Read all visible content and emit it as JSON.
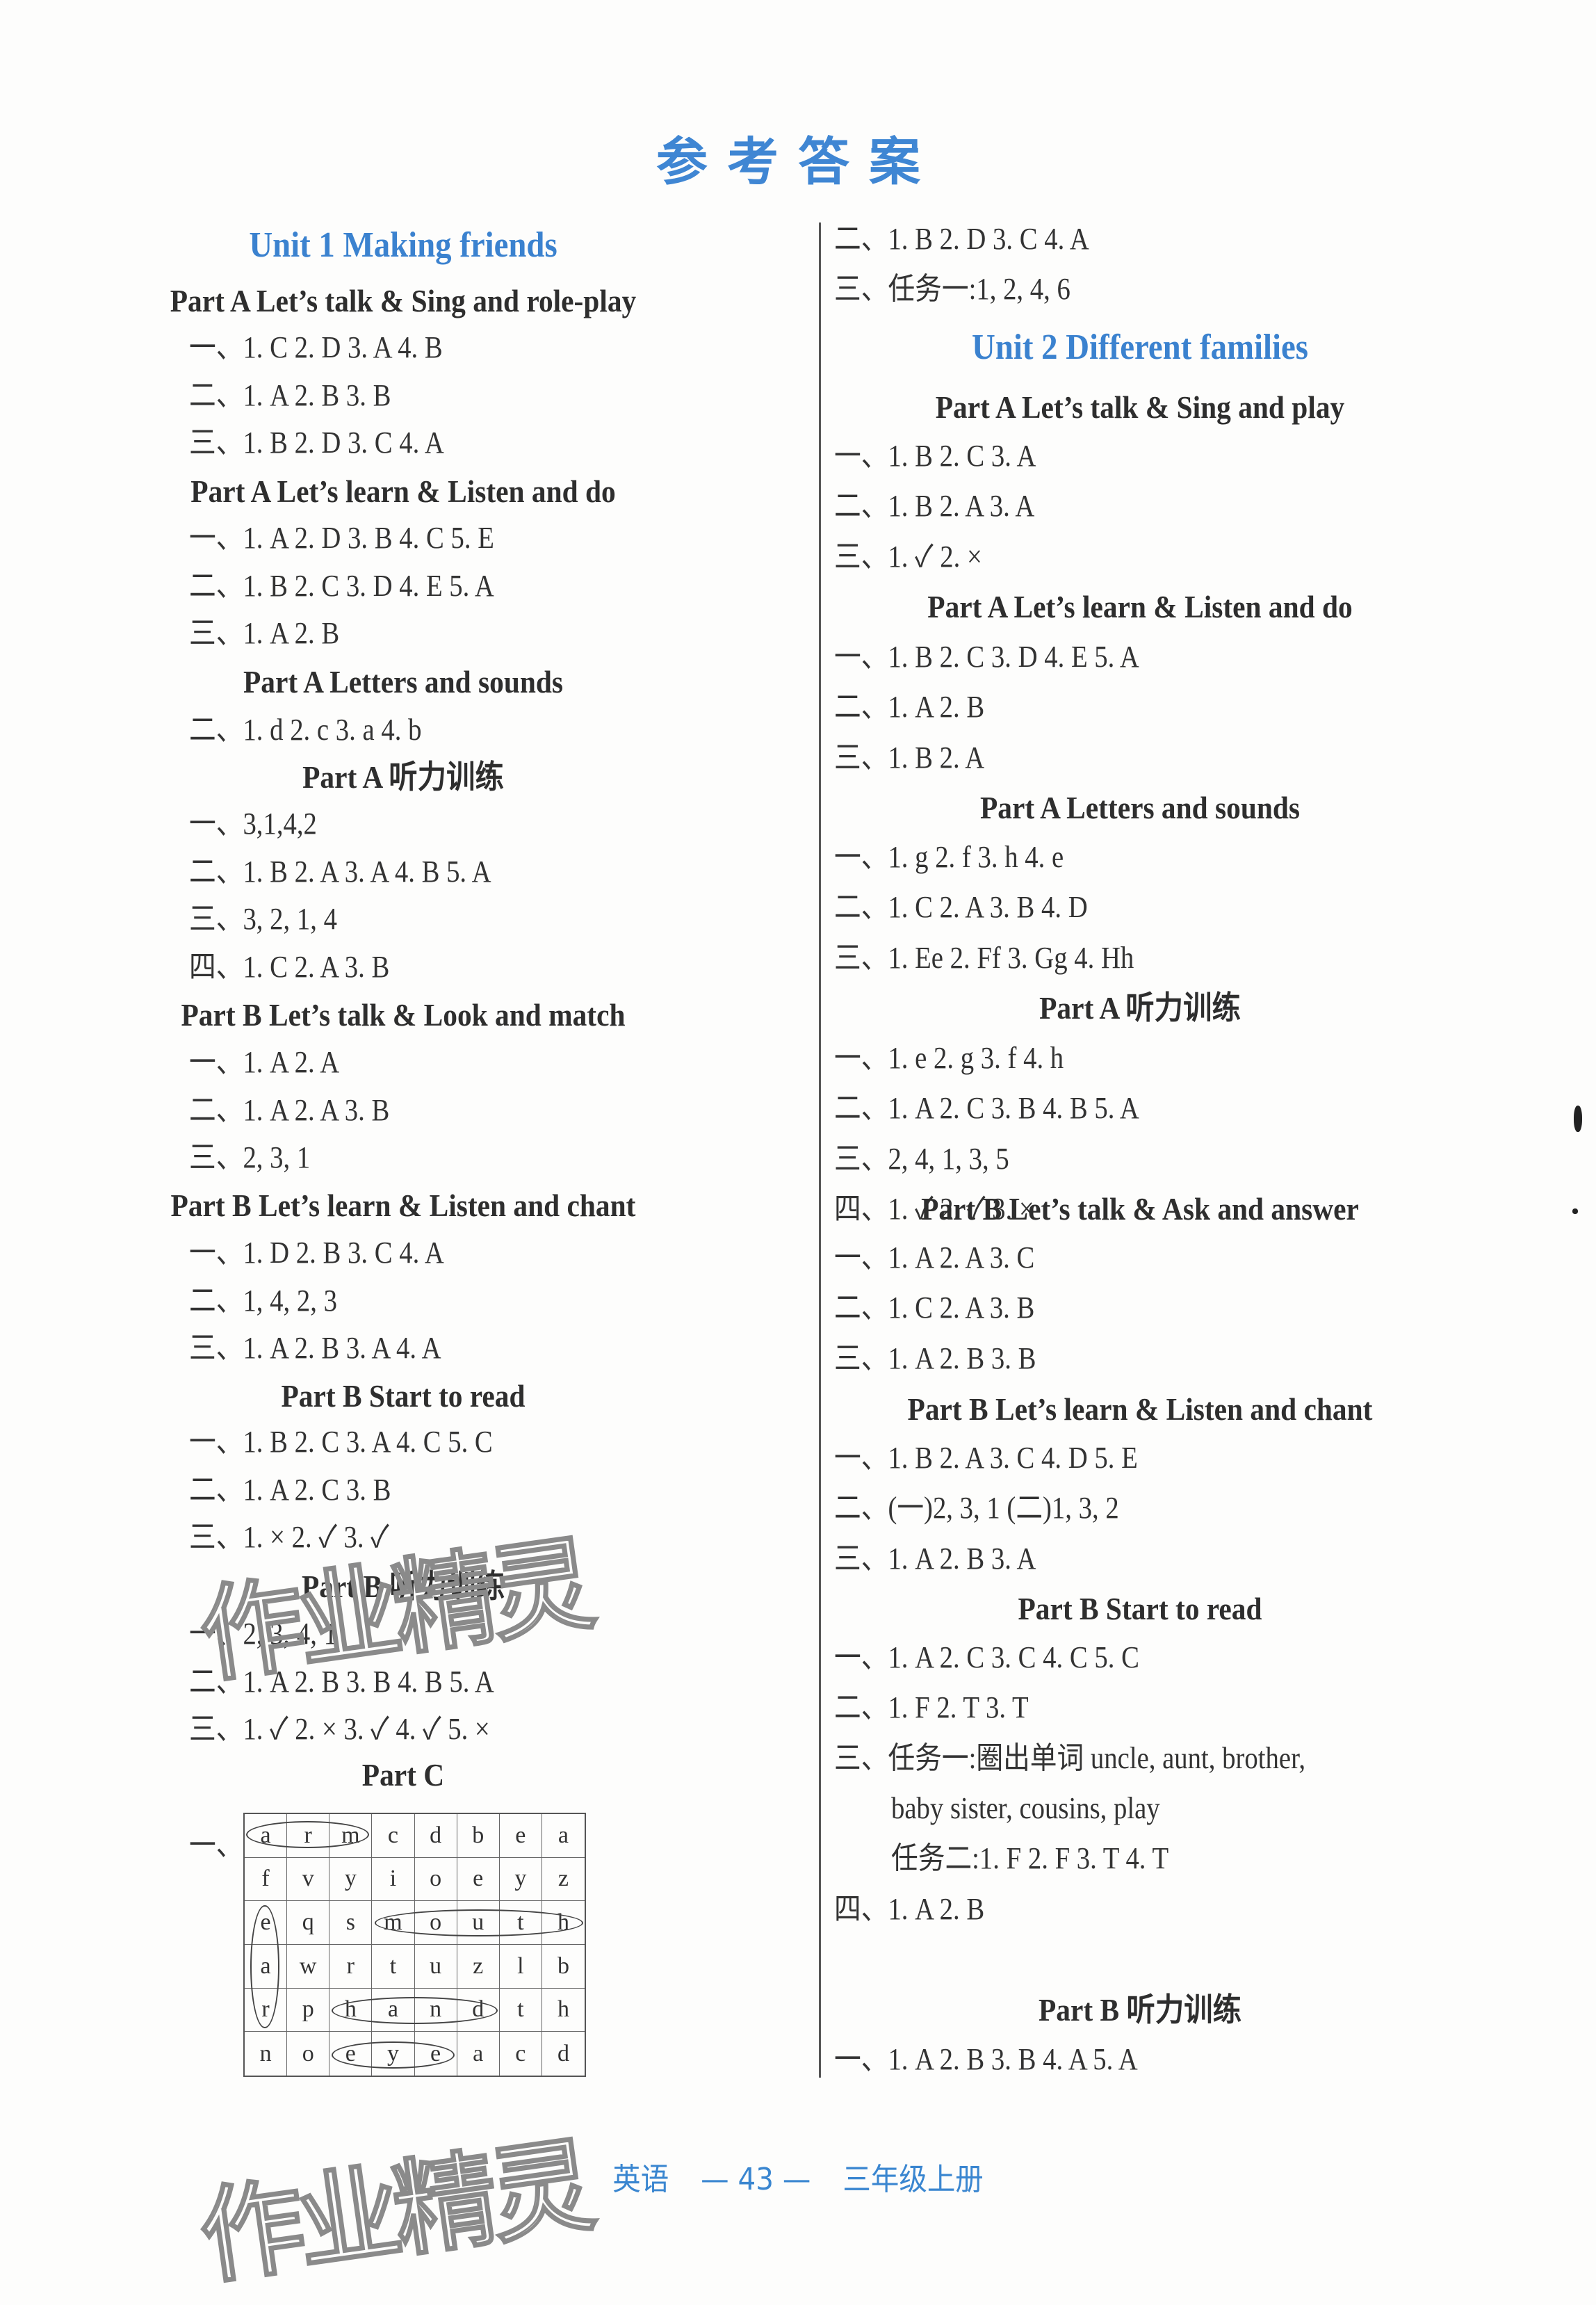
{
  "page_title": "参考答案",
  "left_column": {
    "unit_title": "Unit 1   Making friends",
    "blocks": [
      {
        "heading": "Part A   Let’s talk & Sing and role-play",
        "lines": [
          "一、1. C   2. D  3. A   4. B",
          "二、1. A   2. B   3. B",
          "三、1. B   2. D   3. C   4. A"
        ]
      },
      {
        "heading": "Part A   Let’s learn & Listen and do",
        "lines": [
          "一、1. A   2. D   3. B   4. C   5. E",
          "二、1. B   2. C   3. D   4. E   5. A",
          "三、1. A   2. B"
        ]
      },
      {
        "heading": "Part A   Letters and sounds",
        "lines": [
          "二、1. d   2. c   3. a   4. b"
        ]
      },
      {
        "heading": "Part A   听力训练",
        "lines": [
          "一、3,1,4,2",
          "二、1. B   2. A   3. A   4. B   5. A",
          "三、3, 2, 1, 4",
          "四、1. C   2. A   3. B"
        ]
      },
      {
        "heading": "Part B   Let’s talk & Look and match",
        "lines": [
          "一、1. A   2. A",
          "二、1. A   2. A   3. B",
          "三、2, 3, 1"
        ]
      },
      {
        "heading": "Part B   Let’s learn & Listen and chant",
        "lines": [
          "一、1. D   2. B   3. C   4. A",
          "二、1, 4, 2, 3",
          "三、1. A   2. B   3. A   4. A"
        ]
      },
      {
        "heading": "Part B   Start to read",
        "lines": [
          "一、1. B   2. C   3. A   4. C   5. C",
          "二、1. A   2. C   3. B",
          "三、1. ×   2. ✓   3. ✓"
        ]
      },
      {
        "heading": "Part B   听力训练",
        "lines": [
          "一、2, 3, 4, 1",
          "二、1. A   2. B   3. B   4. B   5. A",
          "三、1. ✓   2. ×   3. ✓   4. ✓   5. ×"
        ]
      }
    ],
    "part_c": {
      "heading": "Part C",
      "label": "一、",
      "grid": [
        [
          "a",
          "r",
          "m",
          "c",
          "d",
          "b",
          "e",
          "a"
        ],
        [
          "f",
          "v",
          "y",
          "i",
          "o",
          "e",
          "y",
          "z"
        ],
        [
          "e",
          "q",
          "s",
          "m",
          "o",
          "u",
          "t",
          "h"
        ],
        [
          "a",
          "w",
          "r",
          "t",
          "u",
          "z",
          "l",
          "b"
        ],
        [
          "r",
          "p",
          "h",
          "a",
          "n",
          "d",
          "t",
          "h"
        ],
        [
          "n",
          "o",
          "e",
          "y",
          "e",
          "a",
          "c",
          "d"
        ]
      ],
      "circled_words": [
        "arm",
        "ear",
        "mouth",
        "hand",
        "eye"
      ]
    }
  },
  "right_column": {
    "carryover_lines": [
      "二、1. B   2. D   3. C   4. A",
      "三、任务一:1, 2, 4, 6"
    ],
    "unit_title": "Unit 2   Different families",
    "blocks": [
      {
        "heading": "Part A   Let’s talk & Sing and play",
        "lines": [
          "一、1. B   2. C   3. A",
          "二、1. B   2. A   3. A",
          "三、1. ✓   2. ×"
        ]
      },
      {
        "heading": "Part A   Let’s learn & Listen and do",
        "lines": [
          "一、1. B   2. C   3. D   4. E   5. A",
          "二、1. A   2. B",
          "三、1. B   2. A"
        ]
      },
      {
        "heading": "Part A   Letters and sounds",
        "lines": [
          "一、1. g   2. f   3. h   4. e",
          "二、1. C   2. A   3. B   4. D",
          "三、1. Ee   2. Ff   3. Gg   4. Hh"
        ]
      },
      {
        "heading": "Part A   听力训练",
        "lines": [
          "一、1. e   2. g   3. f   4. h",
          "二、1. A   2. C   3. B   4. B   5. A",
          "三、2, 4, 1, 3, 5",
          "四、1. ✓   2. ✓   3. ×"
        ]
      },
      {
        "heading": "Part B   Let’s talk & Ask and answer",
        "lines": [
          "一、1. A   2. A   3. C",
          "二、1. C   2. A   3. B",
          "三、1. A   2. B   3. B"
        ]
      },
      {
        "heading": "Part B   Let’s learn & Listen and chant",
        "lines": [
          "一、1. B   2. A   3. C   4. D   5. E",
          "二、(一)2, 3, 1   (二)1, 3, 2",
          "三、1. A   2. B   3. A"
        ]
      },
      {
        "heading": "Part B   Start to read",
        "lines": [
          "一、1. A   2. C   3. C   4. C   5. C",
          "二、1. F   2. T   3. T",
          "三、任务一:圈出单词 uncle, aunt, brother,",
          "baby sister, cousins, play",
          "任务二:1. F   2. F   3. T   4. T",
          "四、1. A   2. B"
        ]
      },
      {
        "heading": "Part B   听力训练",
        "lines": [
          "一、1. A   2. B   3. B   4. A   5. A"
        ]
      }
    ]
  },
  "footer": {
    "subject": "英语",
    "page_number": "— 43 —",
    "grade": "三年级上册"
  },
  "watermark": "作业精灵",
  "colors": {
    "accent_blue": "#3b82cf",
    "text": "#2e2e2e"
  }
}
